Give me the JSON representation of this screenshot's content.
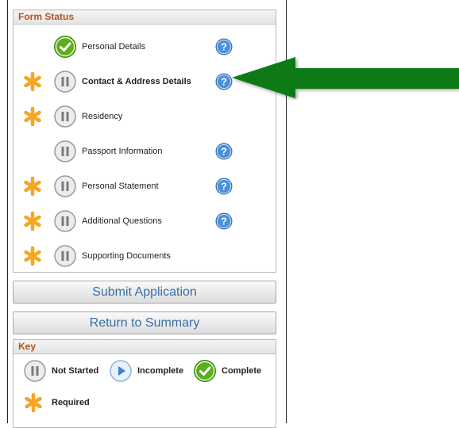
{
  "form_status": {
    "title": "Form Status",
    "items": [
      {
        "label": "Personal Details",
        "status": "complete",
        "required": false,
        "help": true,
        "bold": false
      },
      {
        "label": "Contact & Address Details",
        "status": "not-started",
        "required": true,
        "help": true,
        "bold": true
      },
      {
        "label": "Residency",
        "status": "not-started",
        "required": true,
        "help": false,
        "bold": false
      },
      {
        "label": "Passport Information",
        "status": "not-started",
        "required": false,
        "help": true,
        "bold": false
      },
      {
        "label": "Personal Statement",
        "status": "not-started",
        "required": true,
        "help": true,
        "bold": false
      },
      {
        "label": "Additional Questions",
        "status": "not-started",
        "required": true,
        "help": true,
        "bold": false
      },
      {
        "label": "Supporting Documents",
        "status": "not-started",
        "required": true,
        "help": false,
        "bold": false
      }
    ]
  },
  "buttons": {
    "submit": "Submit Application",
    "return": "Return to Summary"
  },
  "key": {
    "title": "Key",
    "not_started": "Not Started",
    "incomplete": "Incomplete",
    "complete": "Complete",
    "required": "Required"
  },
  "colors": {
    "header_text": "#b3531c",
    "complete_green": "#5cae1c",
    "help_blue": "#4a90d9",
    "arrow_green": "#0a7a12",
    "required_orange": "#f5a623"
  }
}
